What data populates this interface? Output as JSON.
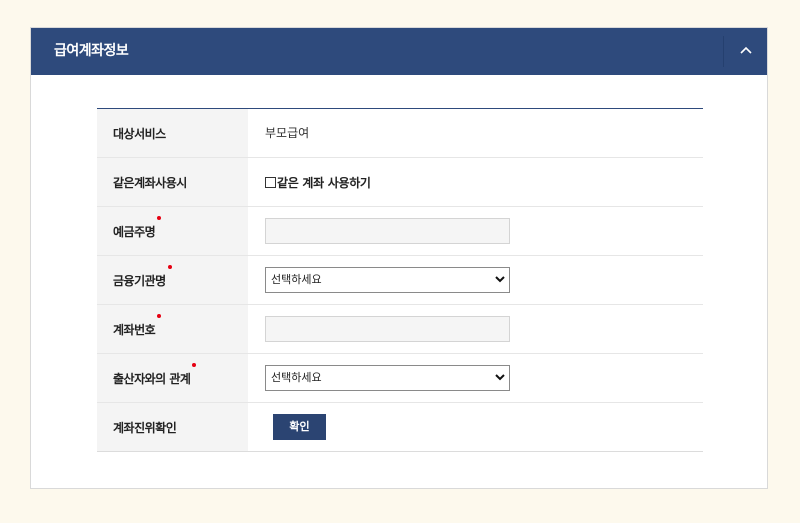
{
  "panel": {
    "title": "급여계좌정보",
    "collapse_icon": "chevron-up-icon"
  },
  "form": {
    "service": {
      "label": "대상서비스",
      "value": "부모급여"
    },
    "same_account": {
      "label": "같은계좌사용시",
      "checkbox_label": "같은 계좌 사용하기",
      "checked": false
    },
    "depositor": {
      "label": "예금주명",
      "required": true,
      "value": ""
    },
    "bank": {
      "label": "금융기관명",
      "required": true,
      "selected": "선택하세요"
    },
    "account_number": {
      "label": "계좌번호",
      "required": true,
      "value": ""
    },
    "relation": {
      "label": "출산자와의 관계",
      "required": true,
      "selected": "선택하세요"
    },
    "verify": {
      "label": "계좌진위확인",
      "button_label": "확인"
    }
  },
  "colors": {
    "header_bg": "#2e4a7c",
    "button_bg": "#2b4472",
    "required_dot": "#e60012",
    "page_bg": "#fdf9ed"
  }
}
